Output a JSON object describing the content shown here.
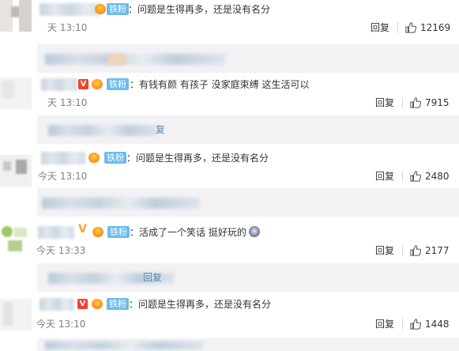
{
  "comments": [
    {
      "text": "：问题是生得再多，还是没有名分",
      "time": "天 13:10",
      "reply_label": "回复",
      "likes": "12169",
      "fan_label": "铁粉"
    },
    {
      "text": "：有钱有颜 有孩子 没家庭束缚 这生活可以",
      "time": "天 13:10",
      "reply_label": "回复",
      "likes": "7915",
      "fan_label": "铁粉",
      "sub_reply_label": "复"
    },
    {
      "text": "：问题是生得再多，还是没有名分",
      "time": "今天 13:10",
      "reply_label": "回复",
      "likes": "2480",
      "fan_label": "铁粉"
    },
    {
      "text": "：活成了一个笑话 挺好玩的",
      "time": "今天 13:33",
      "reply_label": "回复",
      "likes": "2177",
      "fan_label": "铁粉",
      "sub_reply_label": "回复"
    },
    {
      "text": "：问题是生得再多，还是没有名分",
      "time": "今天 13:10",
      "reply_label": "回复",
      "likes": "1448",
      "fan_label": "铁粉"
    }
  ],
  "badge_v_label": "V",
  "colors": {
    "fan_badge": "#6cbbea",
    "vip_badge": "#f43f2e",
    "reply_link": "#5c8bb5",
    "subreply_bg": "#f2f2f5"
  },
  "icons": [
    "thumbs-up-icon",
    "verified-v-icon",
    "fan-level-icon",
    "emoji-face-icon"
  ]
}
